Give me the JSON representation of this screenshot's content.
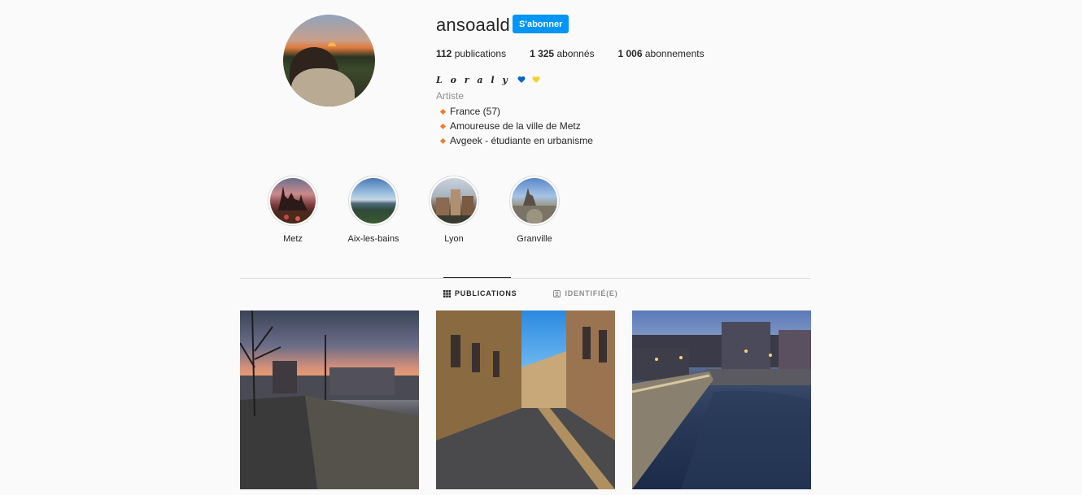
{
  "profile": {
    "username": "ansoaald",
    "follow_label": "S'abonner",
    "stats": [
      {
        "count": "112",
        "label": "publications"
      },
      {
        "count": "1 325",
        "label": "abonnés"
      },
      {
        "count": "1 006",
        "label": "abonnements"
      }
    ],
    "full_name": "L o r a l y",
    "category": "Artiste",
    "bio": [
      "France (57)",
      "Amoureuse de la ville de Metz",
      "Avgeek - étudiante en urbanisme"
    ]
  },
  "highlights": [
    {
      "label": "Metz"
    },
    {
      "label": "Aix-les-bains"
    },
    {
      "label": "Lyon"
    },
    {
      "label": "Granville"
    }
  ],
  "tabs": [
    {
      "label": "PUBLICATIONS",
      "icon": "grid-icon",
      "active": true
    },
    {
      "label": "IDENTIFIÉ(E)",
      "icon": "tagged-icon",
      "active": false
    }
  ],
  "colors": {
    "accent": "#0095f6",
    "bullet": "#f07c2b",
    "heart_blue": "#0a66c2",
    "heart_yellow": "#f5d130"
  }
}
